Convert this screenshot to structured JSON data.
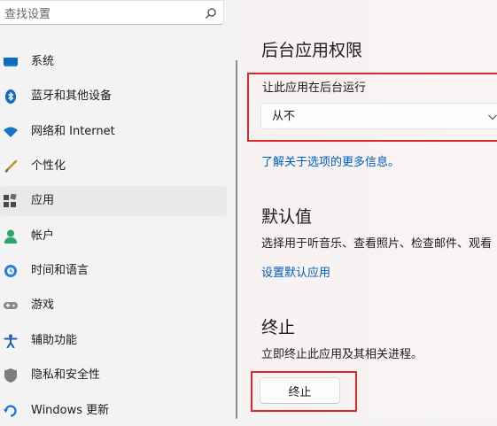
{
  "search": {
    "placeholder": "查找设置"
  },
  "sidebar": {
    "items": [
      {
        "label": "系统",
        "icon": "system-icon"
      },
      {
        "label": "蓝牙和其他设备",
        "icon": "bluetooth-icon"
      },
      {
        "label": "网络和 Internet",
        "icon": "wifi-icon"
      },
      {
        "label": "个性化",
        "icon": "brush-icon"
      },
      {
        "label": "应用",
        "icon": "apps-icon",
        "active": true
      },
      {
        "label": "帐户",
        "icon": "person-icon"
      },
      {
        "label": "时间和语言",
        "icon": "globe-clock-icon"
      },
      {
        "label": "游戏",
        "icon": "gamepad-icon"
      },
      {
        "label": "辅助功能",
        "icon": "accessibility-icon"
      },
      {
        "label": "隐私和安全性",
        "icon": "shield-icon"
      },
      {
        "label": "Windows 更新",
        "icon": "update-icon"
      }
    ]
  },
  "main": {
    "background_permissions": {
      "title": "后台应用权限",
      "setting_label": "让此应用在后台运行",
      "selected_value": "从不",
      "more_info_link": "了解关于选项的更多信息。"
    },
    "defaults": {
      "title": "默认值",
      "description": "选择用于听音乐、查看照片、检查邮件、观看",
      "link": "设置默认应用"
    },
    "terminate": {
      "title": "终止",
      "description": "立即终止此应用及其相关进程。",
      "button_label": "终止"
    }
  },
  "colors": {
    "accent": "#005fb8",
    "highlight": "#d52b2b",
    "active_nav": "#e9e9e9"
  }
}
